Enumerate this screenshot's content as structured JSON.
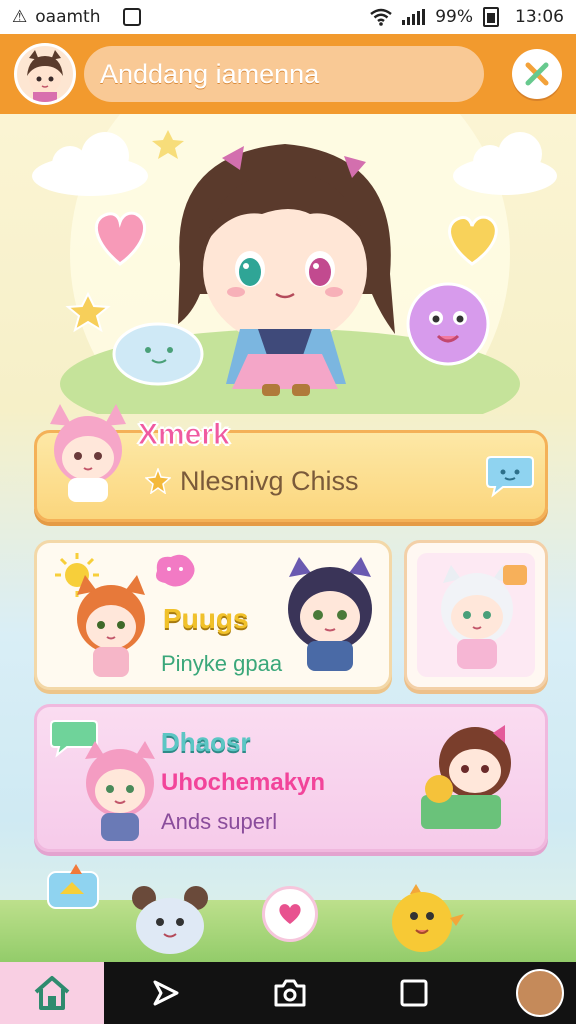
{
  "status_bar": {
    "carrier": "oaamth",
    "battery_percent": "99%",
    "time": "13:06"
  },
  "app_bar": {
    "search_text": "Anddang iamenna"
  },
  "feature_card": {
    "title": "Xmerk",
    "subtitle": "Nlesnivg Chiss"
  },
  "mid_card": {
    "title": "Puugs",
    "subtitle": "Pinyke gpaa"
  },
  "pink_card": {
    "title": "Dhaosr",
    "line1": "Uhochemakyn",
    "line2": "Ands superl"
  },
  "colors": {
    "accent": "#f29a2e",
    "pink": "#f2449a",
    "nav_bg": "#121212"
  },
  "icons": {
    "close": "x-icon",
    "home": "home-icon",
    "send": "send-icon",
    "camera": "camera-icon",
    "square": "square-icon"
  }
}
